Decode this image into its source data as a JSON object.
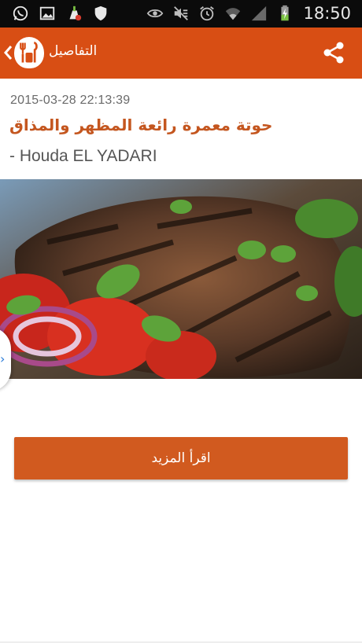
{
  "status_bar": {
    "time": "18:50",
    "left_icons": [
      "whatsapp-icon",
      "gallery-icon",
      "cleaner-icon",
      "shield-icon"
    ],
    "right_icons": [
      "eye-icon",
      "mute-icon",
      "alarm-icon",
      "wifi-icon",
      "signal-icon",
      "battery-charging-icon"
    ]
  },
  "app_bar": {
    "title": "التفاصيل",
    "background": "#d84e14"
  },
  "article": {
    "date": "2015-03-28 22:13:39",
    "title": "حوتة معمرة رائعة المظهر والمذاق",
    "author": "- Houda EL YADARI",
    "title_color": "#c4561f"
  },
  "actions": {
    "read_more_label": "اقرأ المزيد"
  }
}
